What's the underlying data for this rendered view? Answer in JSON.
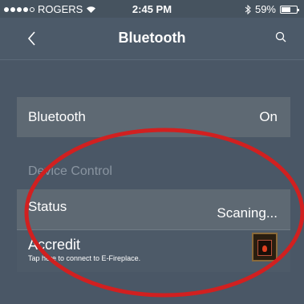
{
  "status_bar": {
    "carrier": "ROGERS",
    "time": "2:45 PM",
    "battery": "59%",
    "battery_level": 0.59,
    "signal_bars": 4
  },
  "nav": {
    "title": "Bluetooth"
  },
  "settings": {
    "bluetooth_label": "Bluetooth",
    "bluetooth_value": "On"
  },
  "device_control": {
    "header": "Device Control",
    "status_label": "Status",
    "status_value": "Scaning...",
    "accredit_label": "Accredit",
    "accredit_sub": "Tap here to connect to E-Fireplace."
  },
  "colors": {
    "annotation": "#d12020",
    "background": "#4a5766"
  },
  "icons": [
    "back-chevron-icon",
    "search-icon",
    "wifi-icon",
    "bluetooth-icon",
    "battery-icon",
    "fireplace-thumbnail"
  ]
}
